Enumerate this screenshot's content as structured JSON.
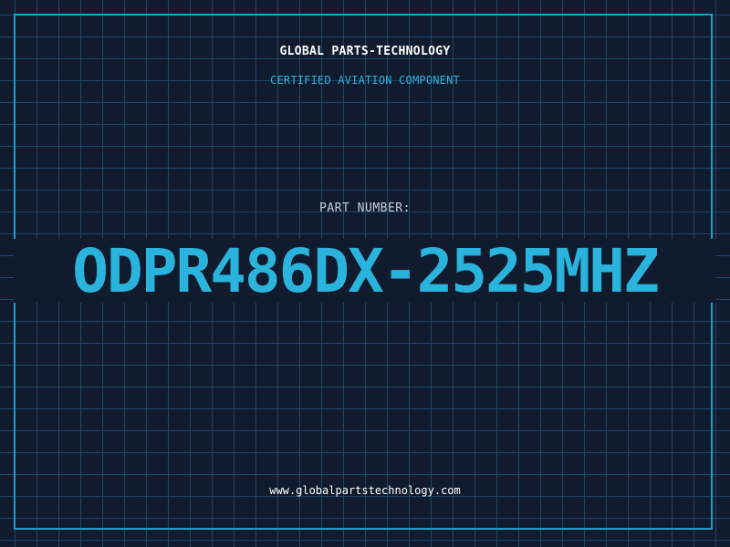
{
  "header": {
    "company": "GLOBAL PARTS-TECHNOLOGY",
    "certification": "CERTIFIED AVIATION COMPONENT"
  },
  "part": {
    "label": "PART NUMBER:",
    "number": "ODPR486DX-2525MHZ"
  },
  "footer": {
    "website": "www.globalpartstechnology.com"
  },
  "colors": {
    "background": "#111b2e",
    "grid": "#1f4e6e",
    "accent": "#2ab3dc",
    "frame": "#1f9ec9",
    "text": "#ffffff"
  }
}
